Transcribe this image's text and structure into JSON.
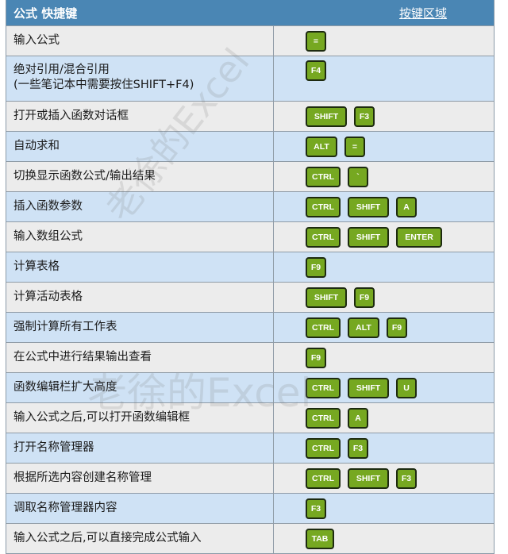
{
  "header": {
    "title": "公式 快捷键",
    "key_zone_label": "按键区域"
  },
  "rows": [
    {
      "desc": [
        "输入公式"
      ],
      "keys": [
        "="
      ]
    },
    {
      "desc": [
        "绝对引用/混合引用",
        "(一些笔记本中需要按住SHIFT+F4)"
      ],
      "keys": [
        "F4"
      ]
    },
    {
      "desc": [
        "打开或插入函数对话框"
      ],
      "keys": [
        "SHIFT",
        "F3"
      ]
    },
    {
      "desc": [
        "自动求和"
      ],
      "keys": [
        "ALT",
        "="
      ]
    },
    {
      "desc": [
        "切换显示函数公式/输出结果"
      ],
      "keys": [
        "CTRL",
        "`"
      ]
    },
    {
      "desc": [
        "插入函数参数"
      ],
      "keys": [
        "CTRL",
        "SHIFT",
        "A"
      ]
    },
    {
      "desc": [
        "输入数组公式"
      ],
      "keys": [
        "CTRL",
        "SHIFT",
        "ENTER"
      ]
    },
    {
      "desc": [
        "计算表格"
      ],
      "keys": [
        "F9"
      ]
    },
    {
      "desc": [
        "计算活动表格"
      ],
      "keys": [
        "SHIFT",
        "F9"
      ]
    },
    {
      "desc": [
        "强制计算所有工作表"
      ],
      "keys": [
        "CTRL",
        "ALT",
        "F9"
      ]
    },
    {
      "desc": [
        "在公式中进行结果输出查看"
      ],
      "keys": [
        "F9"
      ]
    },
    {
      "desc": [
        "函数编辑栏扩大高度"
      ],
      "keys": [
        "CTRL",
        "SHIFT",
        "U"
      ]
    },
    {
      "desc": [
        "输入公式之后,可以打开函数编辑框"
      ],
      "keys": [
        "CTRL",
        "A"
      ]
    },
    {
      "desc": [
        "打开名称管理器"
      ],
      "keys": [
        "CTRL",
        "F3"
      ]
    },
    {
      "desc": [
        "根据所选内容创建名称管理"
      ],
      "keys": [
        "CTRL",
        "SHIFT",
        "F3"
      ]
    },
    {
      "desc": [
        "调取名称管理器内容"
      ],
      "keys": [
        "F3"
      ]
    },
    {
      "desc": [
        "输入公式之后,可以直接完成公式输入"
      ],
      "keys": [
        "TAB"
      ]
    }
  ],
  "watermark": "老徐的Excel",
  "colors": {
    "header_bg": "#4a86b4",
    "key_green": "#76a821",
    "row_odd": "#ececec",
    "row_even": "#cfe2f5"
  }
}
